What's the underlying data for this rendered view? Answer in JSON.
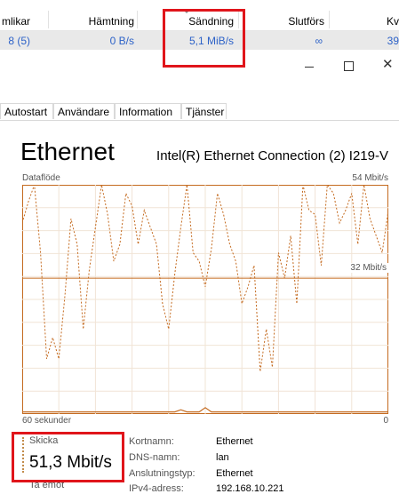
{
  "torrent": {
    "columns": {
      "peers": "mlikar",
      "download": "Hämtning",
      "upload": "Sändning",
      "done": "Slutförs",
      "queue": "Kv"
    },
    "row": {
      "peers": "8 (5)",
      "download": "0 B/s",
      "upload": "5,1 MiB/s",
      "done": "∞",
      "queue": "39"
    }
  },
  "window": {
    "minimize_icon": "minimize-icon",
    "maximize_icon": "maximize-icon",
    "close_label": "✕"
  },
  "tabs": [
    {
      "label": "Autostart"
    },
    {
      "label": "Användare"
    },
    {
      "label": "Information"
    },
    {
      "label": "Tjänster"
    }
  ],
  "performance": {
    "title": "Ethernet",
    "adapter": "Intel(R) Ethernet Connection (2) I219-V",
    "graph_title": "Dataflöde",
    "max_label": "54 Mbit/s",
    "mid_label": "32 Mbit/s",
    "time_label": "60 sekunder",
    "zero_label": "0"
  },
  "stats": {
    "send_label": "Skicka",
    "send_value": "51,3 Mbit/s",
    "receive_label": "Ta emot"
  },
  "properties": [
    {
      "label": "Kortnamn:",
      "value": "Ethernet"
    },
    {
      "label": "DNS-namn:",
      "value": "lan"
    },
    {
      "label": "Anslutningstyp:",
      "value": "Ethernet"
    },
    {
      "label": "IPv4-adress:",
      "value": "192.168.10.221"
    }
  ],
  "colors": {
    "accent_line": "#c46a1f",
    "highlight_box": "#e0151b",
    "link_blue": "#2d62c8"
  },
  "chart_data": {
    "type": "line",
    "title": "Dataflöde",
    "xlabel": "60 sekunder",
    "ylabel": "",
    "ylim": [
      0,
      54
    ],
    "x": [
      60,
      59,
      58,
      57,
      56,
      55,
      54,
      53,
      52,
      51,
      50,
      49,
      48,
      47,
      46,
      45,
      44,
      43,
      42,
      41,
      40,
      39,
      38,
      37,
      36,
      35,
      34,
      33,
      32,
      31,
      30,
      29,
      28,
      27,
      26,
      25,
      24,
      23,
      22,
      21,
      20,
      19,
      18,
      17,
      16,
      15,
      14,
      13,
      12,
      11,
      10,
      9,
      8,
      7,
      6,
      5,
      4,
      3,
      2,
      1,
      0
    ],
    "series": [
      {
        "values": [
          45,
          50,
          54,
          38,
          13,
          18,
          13,
          28,
          46,
          40,
          20,
          34,
          44,
          54,
          47,
          36,
          40,
          52,
          49,
          40,
          48,
          44,
          40,
          26,
          20,
          33,
          44,
          54,
          38,
          36,
          30,
          39,
          52,
          47,
          40,
          36,
          26,
          30,
          35,
          10,
          20,
          11,
          38,
          32,
          42,
          26,
          54,
          48,
          47,
          35,
          54,
          52,
          45,
          48,
          52,
          40,
          54,
          46,
          42,
          38,
          48
        ]
      },
      {
        "values": [
          0.5,
          0.5,
          0.5,
          0.5,
          0.5,
          0.5,
          0.5,
          0.5,
          0.5,
          0.5,
          0.5,
          0.5,
          0.5,
          0.5,
          0.5,
          0.5,
          0.5,
          0.5,
          0.5,
          0.5,
          0.5,
          0.5,
          0.5,
          0.5,
          0.5,
          0.5,
          1,
          0.5,
          0.5,
          0.5,
          1.5,
          0.5,
          0.5,
          0.5,
          0.5,
          0.5,
          0.5,
          0.5,
          0.5,
          0.5,
          0.5,
          0.5,
          0.5,
          0.5,
          0.5,
          0.5,
          0.5,
          0.5,
          0.5,
          0.5,
          0.5,
          0.5,
          0.5,
          0.5,
          0.5,
          0.5,
          0.5,
          0.5,
          0.5,
          0.5,
          0.5
        ]
      }
    ],
    "reference_value": 32,
    "grid": true
  }
}
